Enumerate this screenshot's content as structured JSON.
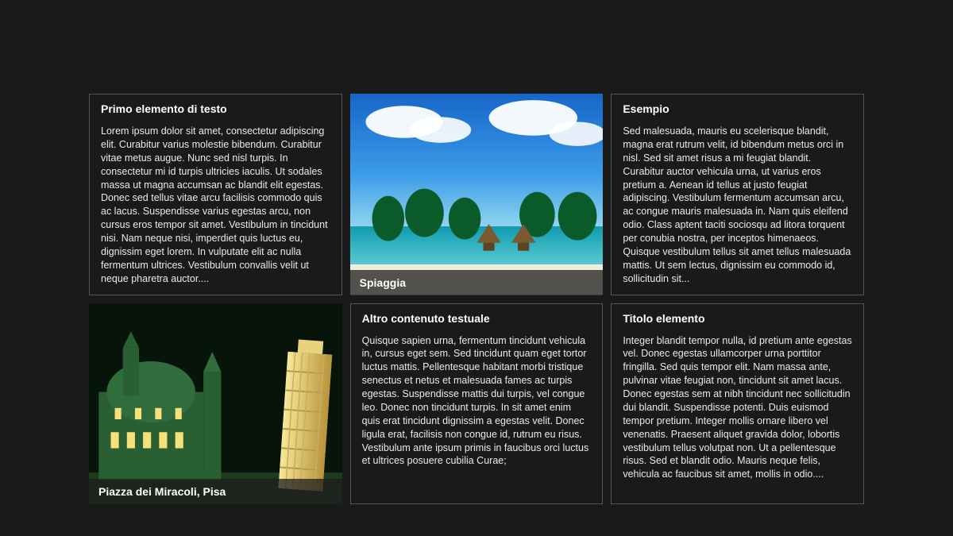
{
  "cards": [
    {
      "title": "Primo elemento di testo",
      "body": "Lorem ipsum dolor sit amet, consectetur adipiscing elit. Curabitur varius molestie bibendum. Curabitur vitae metus augue. Nunc sed nisl turpis. In consectetur mi id turpis ultricies iaculis. Ut sodales massa ut magna accumsan ac blandit elit egestas. Donec sed tellus vitae arcu facilisis commodo quis ac lacus. Suspendisse varius egestas arcu, non cursus eros tempor sit amet. Vestibulum in tincidunt nisi. Nam neque nisi, imperdiet quis luctus eu, dignissim eget lorem. In vulputate elit ac nulla fermentum ultrices. Vestibulum convallis velit ut neque pharetra auctor...."
    },
    {
      "caption": "Spiaggia"
    },
    {
      "title": "Esempio",
      "body": "Sed malesuada, mauris eu scelerisque blandit, magna erat rutrum velit, id bibendum metus orci in nisl. Sed sit amet risus a mi feugiat blandit. Curabitur auctor vehicula urna, ut varius eros pretium a. Aenean id tellus at justo feugiat adipiscing. Vestibulum fermentum accumsan arcu, ac congue mauris malesuada in. Nam quis eleifend odio. Class aptent taciti sociosqu ad litora torquent per conubia nostra, per inceptos himenaeos. Quisque vestibulum tellus sit amet tellus malesuada mattis. Ut sem lectus, dignissim eu commodo id, sollicitudin sit..."
    },
    {
      "caption": "Piazza dei Miracoli, Pisa"
    },
    {
      "title": "Altro contenuto testuale",
      "body": "Quisque sapien urna, fermentum tincidunt vehicula in, cursus eget sem. Sed tincidunt quam eget tortor luctus mattis. Pellentesque habitant morbi tristique senectus et netus et malesuada fames ac turpis egestas. Suspendisse mattis dui turpis, vel congue leo. Donec non tincidunt turpis. In sit amet enim quis erat tincidunt dignissim a egestas velit. Donec ligula erat, facilisis non congue id, rutrum eu risus. Vestibulum ante ipsum primis in faucibus orci luctus et ultrices posuere cubilia Curae;"
    },
    {
      "title": "Titolo elemento",
      "body": "Integer blandit tempor nulla, id pretium ante egestas vel. Donec egestas ullamcorper urna porttitor fringilla. Sed quis tempor elit. Nam massa ante, pulvinar vitae feugiat non, tincidunt sit amet lacus. Donec egestas sem at nibh tincidunt nec sollicitudin dui blandit. Suspendisse potenti. Duis euismod tempor pretium. Integer mollis ornare libero vel venenatis. Praesent aliquet gravida dolor, lobortis vestibulum tellus volutpat non. Ut a pellentesque risus. Sed et blandit odio. Mauris neque felis, vehicula ac faucibus sit amet, mollis in odio...."
    }
  ]
}
